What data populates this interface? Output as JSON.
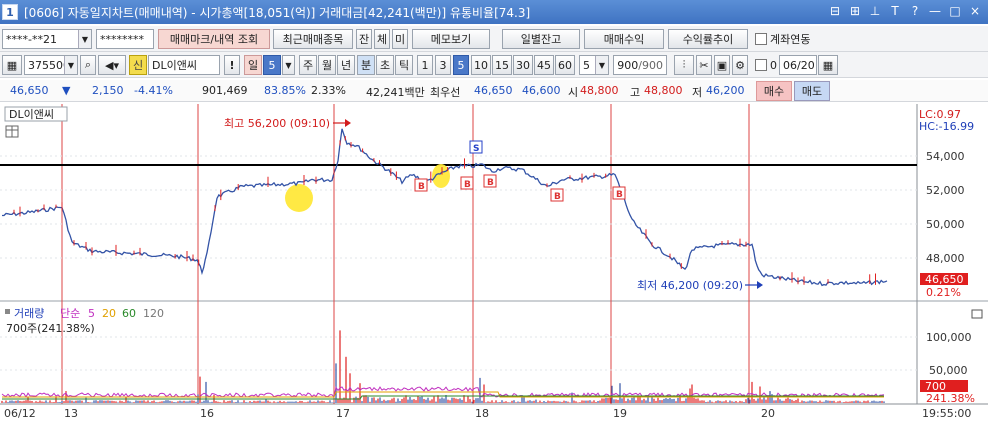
{
  "window": {
    "number": "1",
    "title": "[0606] 자동일지차트(매매내역) - 시가총액[18,051(억)] 거래대금[42,241(백만)] 유통비율[74.3]",
    "buttons": [
      "⊟",
      "⊞",
      "⊥",
      "T",
      "?",
      "—",
      "□",
      "×"
    ]
  },
  "toolbar1": {
    "account": "****-**21",
    "password": "********",
    "buttons": [
      "매매마크/내역 조회",
      "최근매매종목",
      "잔",
      "체",
      "미",
      "메모보기",
      "일별잔고",
      "매매수익",
      "수익률추이"
    ],
    "link_label": "계좌연동"
  },
  "toolbar2": {
    "code": "375500",
    "stock_badge": "신",
    "stock_name": "DL이앤씨",
    "period_selected": "일",
    "period_num": "5",
    "periods": [
      "주",
      "월",
      "년",
      "분",
      "초",
      "틱"
    ],
    "periods_active": "분",
    "intervals": [
      "1",
      "3",
      "5",
      "10",
      "15",
      "30",
      "45",
      "60"
    ],
    "interval_active": "5",
    "interval_input": "5",
    "count": "900",
    "count_total": "/900",
    "checkbox_label": "0",
    "date": "06/20"
  },
  "quote": {
    "price": "46,650",
    "arrow": "▼",
    "change": "2,150",
    "change_pct": "-4.41%",
    "volume": "901,469",
    "vol_pct": "83.85%",
    "turnover": "2.33%",
    "value": "42,241백만",
    "bid_label": "최우선",
    "ask": "46,650",
    "bid": "46,600",
    "open_label": "시",
    "open": "48,800",
    "high_label": "고",
    "high": "48,800",
    "low_label": "저",
    "low": "46,200",
    "buy": "매수",
    "sell": "매도"
  },
  "chart": {
    "symbol_tag": "DL이앤씨",
    "lc": "LC:0.97",
    "hc": "HC:-16.99",
    "max_label": "최고 56,200 (09:10)",
    "min_label": "최저 46,200 (09:20)",
    "price_ticks": [
      "54,000",
      "52,000",
      "50,000",
      "48,000"
    ],
    "current_price": "46,650",
    "current_pct": "0.21%",
    "marks": [
      "B",
      "B",
      "B",
      "S",
      "B",
      "B"
    ],
    "volume_title": "거래량",
    "volume_ma_type": "단순",
    "volume_ma": [
      "5",
      "20",
      "60",
      "120"
    ],
    "volume_info": "700주(241.38%)",
    "volume_ticks": [
      "100,000",
      "50,000"
    ],
    "volume_current": "700",
    "volume_pct": "241.38%",
    "x_labels": [
      "06/12",
      "13",
      "16",
      "17",
      "18",
      "19",
      "20"
    ],
    "time_label": "19:55:00"
  },
  "chart_data": {
    "type": "line",
    "ylim": [
      45400,
      58500
    ],
    "series": [
      {
        "x": [
          0,
          30,
          60,
          70,
          90,
          120,
          150,
          175,
          195,
          200,
          205,
          215,
          240,
          270,
          300,
          310,
          330,
          336,
          340,
          345,
          355,
          370,
          385,
          400,
          410,
          425,
          440,
          455,
          470,
          480,
          490,
          500,
          520,
          545,
          560,
          580,
          600,
          613,
          620,
          630,
          650,
          670,
          683,
          690,
          710,
          730,
          750,
          755,
          760,
          780,
          800,
          820,
          840,
          860,
          885
        ],
        "values": [
          50500,
          50700,
          51000,
          48900,
          48400,
          48300,
          48200,
          48100,
          47900,
          47200,
          48200,
          51600,
          52200,
          52300,
          52400,
          52600,
          52600,
          53800,
          55600,
          54800,
          54600,
          53800,
          53200,
          52500,
          52900,
          52500,
          53000,
          53400,
          53400,
          53500,
          53100,
          53300,
          53200,
          52200,
          52600,
          52700,
          52800,
          52900,
          51800,
          50200,
          48800,
          48000,
          47300,
          48500,
          48700,
          48800,
          48800,
          47500,
          47000,
          46800,
          46600,
          46500,
          46550,
          46500,
          46650
        ]
      }
    ],
    "y_ticks": [
      54000,
      52000,
      50000,
      48000
    ],
    "max": {
      "value": 56200,
      "time": "09:10"
    },
    "min": {
      "value": 46200,
      "time": "09:20"
    },
    "volume_ylim": [
      0,
      140000
    ],
    "volume_ticks": [
      100000,
      50000
    ]
  }
}
